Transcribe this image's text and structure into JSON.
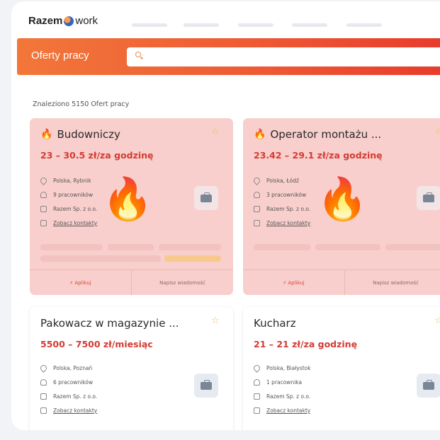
{
  "header": {
    "logo_part1": "Razem",
    "logo_part2": "work"
  },
  "banner": {
    "title": "Oferty pracy",
    "search_placeholder": ""
  },
  "results_text": "Znaleziono 5150 Ofert pracy",
  "cards": [
    {
      "title": "Budowniczy",
      "salary": "23 – 30.5 zł/za godzinę",
      "location": "Polska, Rybnik",
      "workers": "9 pracowników",
      "company": "Razem Sp. z o.o.",
      "contacts": "Zobacz kontakty",
      "apply": "Aplikuj",
      "message": "Napisz wiadomość",
      "hot": true
    },
    {
      "title": "Operator montażu ...",
      "salary": "23.42 – 29.1 zł/za godzinę",
      "location": "Polska, Łódź",
      "workers": "3 pracowników",
      "company": "Razem Sp. z o.o.",
      "contacts": "Zobacz kontakty",
      "apply": "Aplikuj",
      "message": "Napisz wiadomość",
      "hot": true
    },
    {
      "title": "Pakowacz w magazynie ...",
      "salary": "5500 – 7500 zł/miesiąc",
      "location": "Polska, Poznań",
      "workers": "6 pracowników",
      "company": "Razem Sp. z o.o.",
      "contacts": "Zobacz kontakty",
      "hot": false
    },
    {
      "title": "Kucharz",
      "salary": "21 – 21 zł/za godzinę",
      "location": "Polska, Białystok",
      "workers": "1 pracownika",
      "company": "Razem Sp. z o.o.",
      "contacts": "Zobacz kontakty",
      "hot": false
    }
  ],
  "icons": {
    "hot": "🔥",
    "star": "☆",
    "flame": "🔥"
  },
  "colors": {
    "accent": "#ee5a34",
    "salary": "#d33b34",
    "hot_card_bg": "#f8cfcc"
  }
}
